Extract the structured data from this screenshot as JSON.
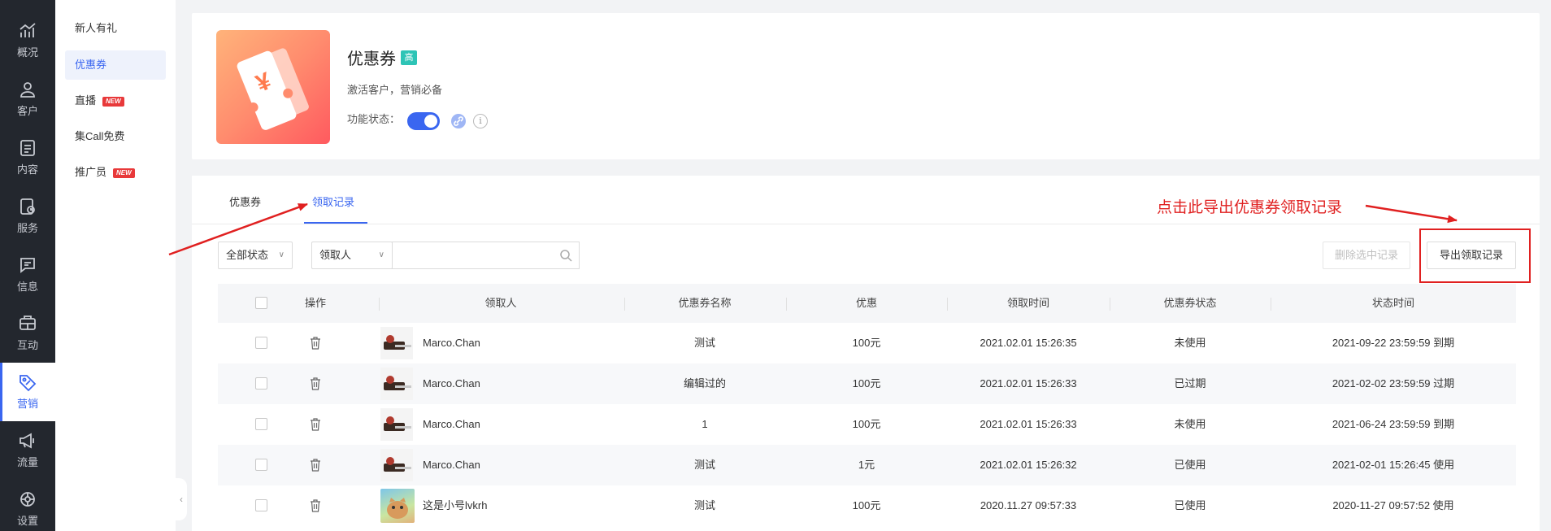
{
  "nav": {
    "items": [
      {
        "label": "概况",
        "icon": "chart-trend-icon"
      },
      {
        "label": "客户",
        "icon": "user-icon"
      },
      {
        "label": "内容",
        "icon": "document-icon"
      },
      {
        "label": "服务",
        "icon": "service-icon"
      },
      {
        "label": "信息",
        "icon": "message-icon"
      },
      {
        "label": "互动",
        "icon": "interaction-icon"
      },
      {
        "label": "营销",
        "icon": "tag-icon",
        "active": true
      },
      {
        "label": "流量",
        "icon": "megaphone-icon"
      },
      {
        "label": "设置",
        "icon": "settings-icon"
      }
    ]
  },
  "submenu": {
    "items": [
      {
        "label": "新人有礼"
      },
      {
        "label": "优惠券",
        "active": true
      },
      {
        "label": "直播",
        "badge": "NEW"
      },
      {
        "label": "集Call免费"
      },
      {
        "label": "推广员",
        "badge": "NEW"
      }
    ]
  },
  "header": {
    "coupon_symbol": "¥",
    "title": "优惠券",
    "tag": "高",
    "description": "激活客户，营销必备",
    "status_label": "功能状态：",
    "status_on": true,
    "info_symbol": "i"
  },
  "tabs": [
    {
      "label": "优惠券"
    },
    {
      "label": "领取记录",
      "active": true
    }
  ],
  "filters": {
    "status_select": "全部状态",
    "field_select": "领取人",
    "search_value": ""
  },
  "buttons": {
    "delete_selected": "删除选中记录",
    "export": "导出领取记录"
  },
  "annotation": {
    "text": "点击此导出优惠券领取记录"
  },
  "colors": {
    "accent": "#3a66f0",
    "annotation": "#e02020",
    "nav_bg": "#23272e"
  },
  "table": {
    "columns": [
      "操作",
      "领取人",
      "优惠券名称",
      "优惠",
      "领取时间",
      "优惠券状态",
      "状态时间"
    ],
    "rows": [
      {
        "user": "Marco.Chan",
        "coupon": "测试",
        "discount": "100元",
        "time": "2021.02.01 15:26:35",
        "status": "未使用",
        "status_time": "2021-09-22 23:59:59 到期"
      },
      {
        "user": "Marco.Chan",
        "coupon": "编辑过的",
        "discount": "100元",
        "time": "2021.02.01 15:26:33",
        "status": "已过期",
        "status_time": "2021-02-02 23:59:59 过期"
      },
      {
        "user": "Marco.Chan",
        "coupon": "1",
        "discount": "100元",
        "time": "2021.02.01 15:26:33",
        "status": "未使用",
        "status_time": "2021-06-24 23:59:59 到期"
      },
      {
        "user": "Marco.Chan",
        "coupon": "测试",
        "discount": "1元",
        "time": "2021.02.01 15:26:32",
        "status": "已使用",
        "status_time": "2021-02-01 15:26:45 使用"
      },
      {
        "user": "这是小号lvkrh",
        "coupon": "测试",
        "discount": "100元",
        "time": "2020.11.27 09:57:33",
        "status": "已使用",
        "status_time": "2020-11-27 09:57:52 使用"
      }
    ]
  }
}
